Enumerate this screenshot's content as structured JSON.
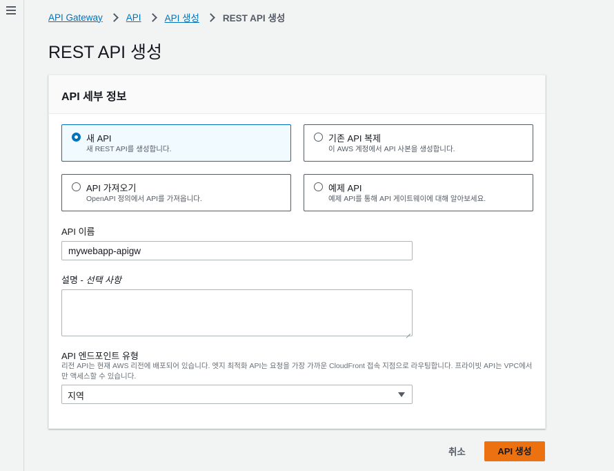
{
  "breadcrumb": {
    "items": [
      "API Gateway",
      "API",
      "API 생성"
    ],
    "current": "REST API 생성"
  },
  "page_title": "REST API 생성",
  "panel": {
    "header": "API 세부 정보",
    "options": [
      {
        "title": "새 API",
        "desc": "새 REST API를 생성합니다.",
        "selected": true
      },
      {
        "title": "기존 API 복제",
        "desc": "이 AWS 계정에서 API 사본을 생성합니다.",
        "selected": false
      },
      {
        "title": "API 가져오기",
        "desc": "OpenAPI 정의에서 API를 가져옵니다.",
        "selected": false
      },
      {
        "title": "예제 API",
        "desc": "예제 API를 통해 API 게이트웨이에 대해 알아보세요.",
        "selected": false
      }
    ],
    "name_label": "API 이름",
    "name_value": "mywebapp-apigw",
    "desc_label": "설명 - ",
    "desc_optional": "선택 사항",
    "desc_value": "",
    "endpoint_label": "API 엔드포인트 유형",
    "endpoint_hint": "리전 API는 현재 AWS 리전에 배포되어 있습니다. 엣지 최적화 API는 요청을 가장 가까운 CloudFront 접속 지점으로 라우팅합니다. 프라이빗 API는 VPC에서만 액세스할 수 있습니다.",
    "endpoint_value": "지역"
  },
  "actions": {
    "cancel": "취소",
    "create": "API 생성"
  },
  "colors": {
    "accent": "#0073bb",
    "primary_button": "#ec7211",
    "selected_tile_bg": "#f1faff"
  },
  "icons": [
    "menu-icon",
    "chevron-right-icon",
    "caret-down-icon"
  ]
}
